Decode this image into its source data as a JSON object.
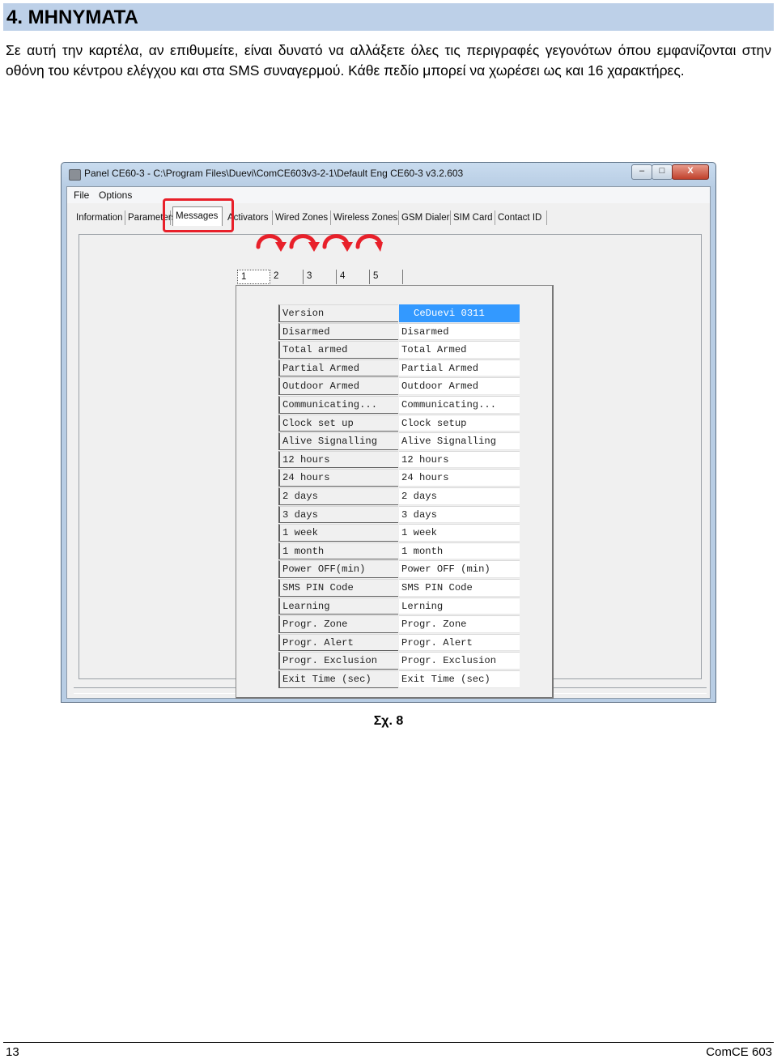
{
  "section_heading": "4. ΜΗΝΥΜΑΤΑ",
  "intro_text": "Σε αυτή την καρτέλα, αν επιθυμείτε, είναι δυνατό να αλλάξετε όλες τις περιγραφές γεγονότων όπου εμφανίζονται στην οθόνη του κέντρου ελέγχου και στα SMS συναγερμού. Κάθε πεδίο μπορεί να χωρέσει ως και 16 χαρακτήρες.",
  "window": {
    "title": "Panel CE60-3 - C:\\Program Files\\Duevi\\ComCE603v3-2-1\\Default Eng CE60-3 v3.2.603",
    "controls": {
      "minimize": "–",
      "maximize": "□",
      "close": "X"
    },
    "menu": [
      "File",
      "Options"
    ],
    "tabs": [
      "Information",
      "Parameters",
      "Messages",
      "Activators",
      "Wired Zones",
      "Wireless Zones",
      "GSM Dialer",
      "SIM Card",
      "Contact ID"
    ],
    "active_tab": "Messages",
    "subtabs": [
      "1",
      "2",
      "3",
      "4",
      "5"
    ],
    "messages": [
      {
        "default": "Version",
        "custom": "CeDuevi 0311"
      },
      {
        "default": "Disarmed",
        "custom": "Disarmed"
      },
      {
        "default": "Total armed",
        "custom": "Total Armed"
      },
      {
        "default": "Partial Armed",
        "custom": "Partial Armed"
      },
      {
        "default": "Outdoor Armed",
        "custom": "Outdoor Armed"
      },
      {
        "default": "Communicating...",
        "custom": "Communicating..."
      },
      {
        "default": "Clock set up",
        "custom": "Clock setup"
      },
      {
        "default": "Alive Signalling",
        "custom": "Alive Signalling"
      },
      {
        "default": "12 hours",
        "custom": "12 hours"
      },
      {
        "default": "24 hours",
        "custom": "24 hours"
      },
      {
        "default": "2 days",
        "custom": "2 days"
      },
      {
        "default": "3 days",
        "custom": "3 days"
      },
      {
        "default": "1 week",
        "custom": "1 week"
      },
      {
        "default": "1 month",
        "custom": "1 month"
      },
      {
        "default": "Power OFF(min)",
        "custom": "Power OFF (min)"
      },
      {
        "default": "SMS PIN Code",
        "custom": "SMS PIN Code"
      },
      {
        "default": "Learning",
        "custom": "Lerning"
      },
      {
        "default": "Progr. Zone",
        "custom": "Progr. Zone"
      },
      {
        "default": "Progr. Alert",
        "custom": "Progr. Alert"
      },
      {
        "default": "Progr. Exclusion",
        "custom": "Progr. Exclusion"
      },
      {
        "default": "Exit Time (sec)",
        "custom": "Exit Time (sec)"
      }
    ]
  },
  "colors": {
    "heading_bg": "#bdd0e8",
    "highlight": "#e8202a",
    "selection": "#3399ff"
  },
  "caption": "Σχ. 8",
  "footer": {
    "page_number": "13",
    "document_name": "ComCE 603"
  }
}
